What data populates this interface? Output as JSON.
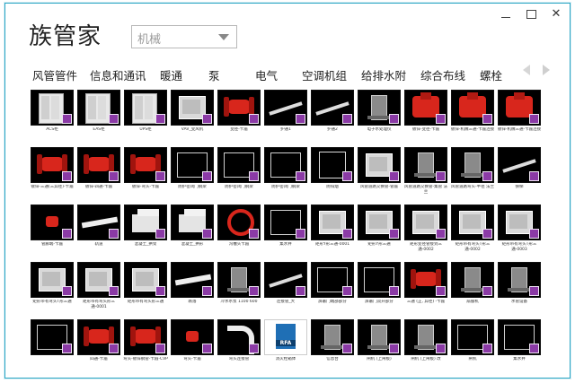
{
  "window": {
    "title": "族管家",
    "controls": {
      "minimize": "—",
      "maximize": "□",
      "close": "✕"
    }
  },
  "category_select": {
    "value": "机械"
  },
  "tabs": [
    {
      "label": "风管管件"
    },
    {
      "label": "信息和通讯"
    },
    {
      "label": "暖通"
    },
    {
      "label": "泵"
    },
    {
      "label": "电气"
    },
    {
      "label": "空调机组"
    },
    {
      "label": "给排水附"
    },
    {
      "label": "综合布线"
    },
    {
      "label": "螺栓"
    }
  ],
  "items": [
    {
      "label": "ACS柜",
      "style": "cabinet"
    },
    {
      "label": "EAS柜",
      "style": "cabinet"
    },
    {
      "label": "UPS柜",
      "style": "cabinet"
    },
    {
      "label": "VAV_变风机",
      "style": "box-white"
    },
    {
      "label": "变径-卡箍",
      "style": "red-valve"
    },
    {
      "label": "护通1",
      "style": "pipe-white"
    },
    {
      "label": "护通2",
      "style": "pipe-white"
    },
    {
      "label": "电子水处理仪",
      "style": "device"
    },
    {
      "label": "镀锌-变径-卡箍",
      "style": "red-fitting"
    },
    {
      "label": "镀锌-机械三通-卡箍连接",
      "style": "red-fitting"
    },
    {
      "label": "镀锌-机械三通-卡箍连接",
      "style": "red-fitting"
    },
    {
      "label": "镀锌-三通(三异径)-卡箍",
      "style": "red-valve"
    },
    {
      "label": "镀锌-四通-卡箍",
      "style": "red-valve"
    },
    {
      "label": "镀锌-弯头-卡箍",
      "style": "red-valve"
    },
    {
      "label": "防护密闭门钢梁",
      "style": "frame"
    },
    {
      "label": "防护密闭门钢梁",
      "style": "frame"
    },
    {
      "label": "防护密闭门钢梁",
      "style": "frame"
    },
    {
      "label": "防排烟",
      "style": "panel"
    },
    {
      "label": "风管道路交换管-管箍",
      "style": "box-white"
    },
    {
      "label": "风管道路交换管-集管 法兰",
      "style": "device"
    },
    {
      "label": "风管道路弯头-半径 法兰",
      "style": "device"
    },
    {
      "label": "扶梯",
      "style": "pipe-white"
    },
    {
      "label": "管廊端-卡箍",
      "style": "red-small"
    },
    {
      "label": "轨道",
      "style": "rail"
    },
    {
      "label": "混凝土_拱架",
      "style": "block"
    },
    {
      "label": "混凝土_拱形",
      "style": "block"
    },
    {
      "label": "沟槽头卡箍",
      "style": "red-ring"
    },
    {
      "label": "集水井",
      "style": "frame"
    },
    {
      "label": "矩形Y形三通-0001",
      "style": "box-white"
    },
    {
      "label": "矩形Y形三通",
      "style": "box-white"
    },
    {
      "label": "矩形变径管接到三通-0002",
      "style": "box-white"
    },
    {
      "label": "矩形带有弯头T形三通-0002",
      "style": "box-white"
    },
    {
      "label": "矩形带有弯头T形三通-0003",
      "style": "box-white"
    },
    {
      "label": "矩形带有弯头T形三通",
      "style": "box-white"
    },
    {
      "label": "矩形带有弯头形三通-0001",
      "style": "box-white"
    },
    {
      "label": "矩形带有弯头形三通",
      "style": "box-white"
    },
    {
      "label": "跌落",
      "style": "rail"
    },
    {
      "label": "冷水水泵 1100 600",
      "style": "device"
    },
    {
      "label": "连接管_大",
      "style": "pipe-white"
    },
    {
      "label": "屏蔽门端部部分",
      "style": "frame"
    },
    {
      "label": "屏蔽门双开部分",
      "style": "frame"
    },
    {
      "label": "三通 (正, 异径) -卡箍",
      "style": "red-valve"
    },
    {
      "label": "扇服机",
      "style": "device"
    },
    {
      "label": "水管设备",
      "style": "device"
    },
    {
      "label": "",
      "style": "frame"
    },
    {
      "label": "四通-卡箍",
      "style": "red-valve"
    },
    {
      "label": "弯头-镀锌钢管-卡箍-CVP",
      "style": "red-valve"
    },
    {
      "label": "弯头-卡箍",
      "style": "red-small"
    },
    {
      "label": "弯头连接管",
      "style": "elbow-white"
    },
    {
      "label": "消火栓箱体",
      "style": "rfa"
    },
    {
      "label": "信息台",
      "style": "device"
    },
    {
      "label": "闸机 (上闸板)",
      "style": "device"
    },
    {
      "label": "闸机 (上闸板) 改",
      "style": "device"
    },
    {
      "label": "闸机",
      "style": "frame"
    },
    {
      "label": "集水井",
      "style": "frame"
    }
  ],
  "rfa_badge": "RFA",
  "colors": {
    "accent": "#2aa6c4",
    "family_badge": "#8b3aa6",
    "fitting_red": "#d8261c"
  }
}
